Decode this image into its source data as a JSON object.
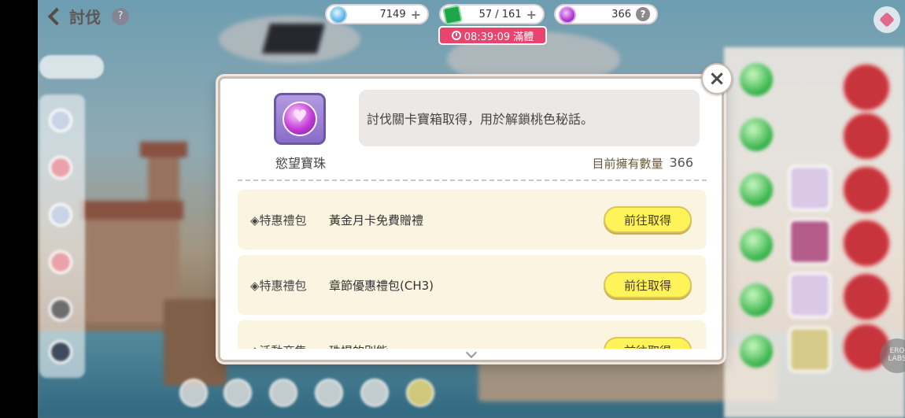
{
  "top_bar": {
    "back_label": "討伐",
    "help_icon": "?"
  },
  "resources": {
    "gems": {
      "value": "7149",
      "plus": "+",
      "icon": "gem-icon"
    },
    "stamina": {
      "value": "57 / 161",
      "plus": "+",
      "icon": "stamina-ticket-icon"
    },
    "orbs": {
      "value": "366",
      "help": "?",
      "icon": "desire-orb-icon"
    }
  },
  "timer": {
    "text": "08:39:09 滿體"
  },
  "modal": {
    "item_name": "慾望寶珠",
    "description": "討伐關卡寶箱取得，用於解鎖桃色秘話。",
    "owned_label": "目前擁有數量",
    "owned_count": "366",
    "close": "×",
    "sources": [
      {
        "category": "◈特惠禮包",
        "name": "黃金月卡免費贈禮",
        "button": "前往取得"
      },
      {
        "category": "◈特惠禮包",
        "name": "章節優惠禮包(CH3)",
        "button": "前往取得"
      },
      {
        "category": "◈活動商集",
        "name": "珠場的別能",
        "button": "前往取得"
      }
    ]
  },
  "colors": {
    "accent_pink": "#e8446f",
    "button_yellow": "#fff35a",
    "row_bg": "#fbf4e0"
  },
  "watermark": "ERO LABS"
}
